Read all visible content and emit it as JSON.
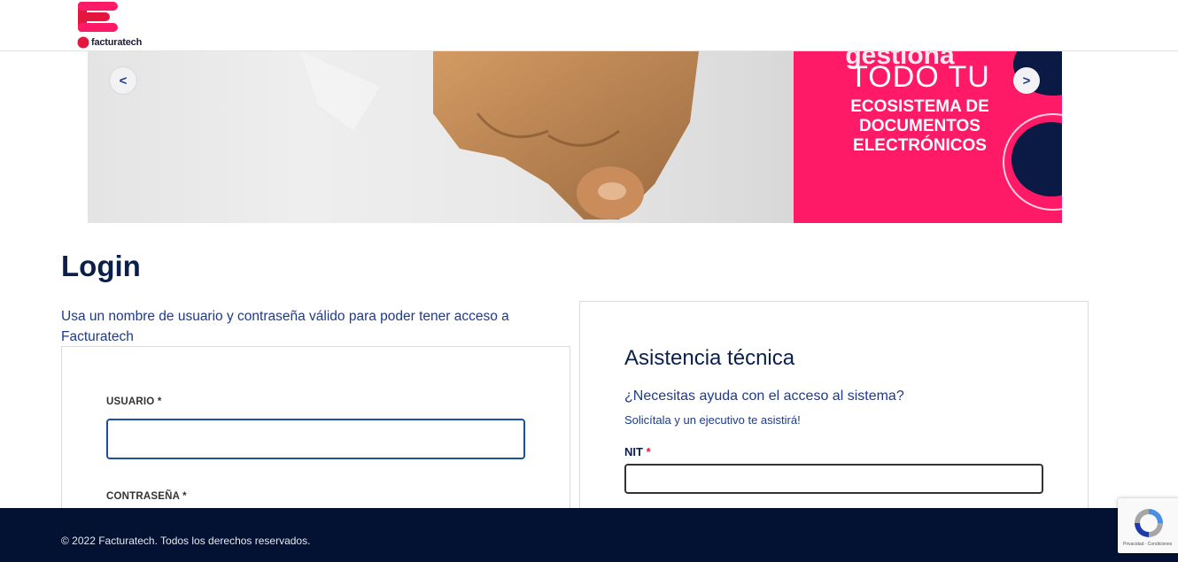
{
  "header": {
    "logo_text": "facturatech"
  },
  "banner": {
    "line1": "gestiona",
    "line2": "TODO TU",
    "line3": [
      "ECOSISTEMA DE",
      "DOCUMENTOS",
      "ELECTRÓNICOS"
    ],
    "prev_label": "<",
    "next_label": ">"
  },
  "login": {
    "title": "Login",
    "intro": "Usa un nombre de usuario y contraseña válido para poder tener acceso a Facturatech",
    "user_label": "USUARIO *",
    "user_value": "",
    "password_label": "CONTRASEÑA *"
  },
  "support": {
    "title": "Asistencia técnica",
    "question": "¿Necesitas ayuda con el acceso al sistema?",
    "subtitle": "Solicítala y un ejecutivo te asistirá!",
    "nit_label": "NIT",
    "nit_required": "*",
    "nit_value": ""
  },
  "footer": {
    "copyright": "© 2022 Facturatech. Todos los derechos reservados."
  },
  "recaptcha": {
    "text": "Privacidad - Condiciones"
  },
  "colors": {
    "brand_pink": "#ff1a67",
    "navy": "#031232",
    "link_blue": "#1e3a8a"
  }
}
